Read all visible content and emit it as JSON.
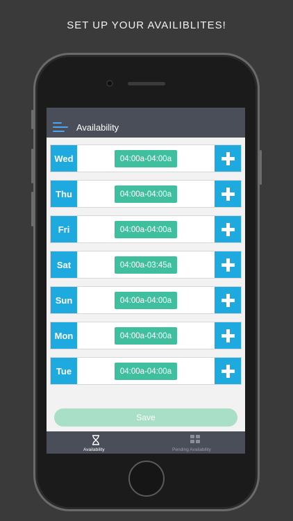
{
  "promo_text": "SET UP YOUR AVAILIBLITES!",
  "header": {
    "title": "Availability",
    "menu_icon": "hamburger-menu-icon"
  },
  "days": [
    {
      "day": "Wed",
      "slot": "04:00a-04:00a"
    },
    {
      "day": "Thu",
      "slot": "04:00a-04:00a"
    },
    {
      "day": "Fri",
      "slot": "04:00a-04:00a"
    },
    {
      "day": "Sat",
      "slot": "04:00a-03:45a"
    },
    {
      "day": "Sun",
      "slot": "04:00a-04:00a"
    },
    {
      "day": "Mon",
      "slot": "04:00a-04:00a"
    },
    {
      "day": "Tue",
      "slot": "04:00a-04:00a"
    }
  ],
  "save_label": "Save",
  "tabs": [
    {
      "label": "Availability",
      "icon": "hourglass-icon",
      "active": true
    },
    {
      "label": "Pending Availability",
      "icon": "grid-icon",
      "active": false
    }
  ],
  "colors": {
    "day_blue": "#1eaadf",
    "slot_green": "#3fbf9e",
    "save_green_disabled": "#a9dfc6",
    "bar_gray": "#4a4e59",
    "menu_icon_blue": "#4ea6f2"
  }
}
